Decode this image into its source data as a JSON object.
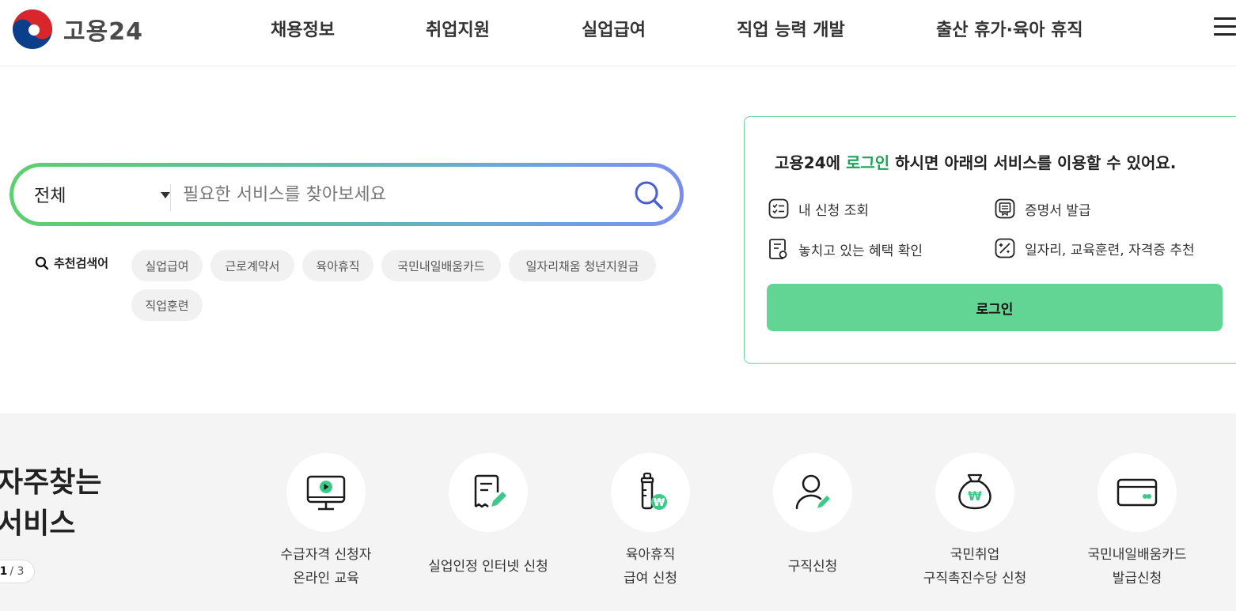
{
  "header": {
    "logo_text": "고용24",
    "nav": [
      "채용정보",
      "취업지원",
      "실업급여",
      "직업 능력 개발",
      "출산 휴가·육아 휴직"
    ]
  },
  "search": {
    "category": "전체",
    "placeholder": "필요한 서비스를 찾아보세요",
    "value": ""
  },
  "recommended": {
    "label": "추천검색어",
    "keywords": [
      "실업급여",
      "근로계약서",
      "육아휴직",
      "국민내일배움카드",
      "일자리채움 청년지원금",
      "직업훈련"
    ]
  },
  "login_box": {
    "title_prefix": "고용24에 ",
    "title_highlight": "로그인",
    "title_suffix": " 하시면 아래의 서비스를 이용할 수 있어요.",
    "services": [
      "내 신청 조회",
      "증명서 발급",
      "놓치고 있는 혜택 확인",
      "일자리, 교육훈련, 자격증 추천"
    ],
    "login_button": "로그인"
  },
  "frequent": {
    "title_line1": "자주찾는",
    "title_line2": "서비스",
    "page_current": "1",
    "page_total": "/ 3",
    "items": [
      {
        "line1": "수급자격 신청자",
        "line2": "온라인 교육",
        "icon": "monitor-play-icon"
      },
      {
        "line1": "실업인정 인터넷 신청",
        "line2": "",
        "icon": "document-pen-icon"
      },
      {
        "line1": "육아휴직",
        "line2": "급여 신청",
        "icon": "baby-bottle-won-icon"
      },
      {
        "line1": "구직신청",
        "line2": "",
        "icon": "person-pen-icon"
      },
      {
        "line1": "국민취업",
        "line2": "구직촉진수당 신청",
        "icon": "money-bag-won-icon"
      },
      {
        "line1": "국민내일배움카드",
        "line2": "발급신청",
        "icon": "card-icon"
      }
    ]
  },
  "colors": {
    "accent_green": "#62d594",
    "highlight_green": "#1ba35a",
    "icon_green": "#3cc98a"
  }
}
